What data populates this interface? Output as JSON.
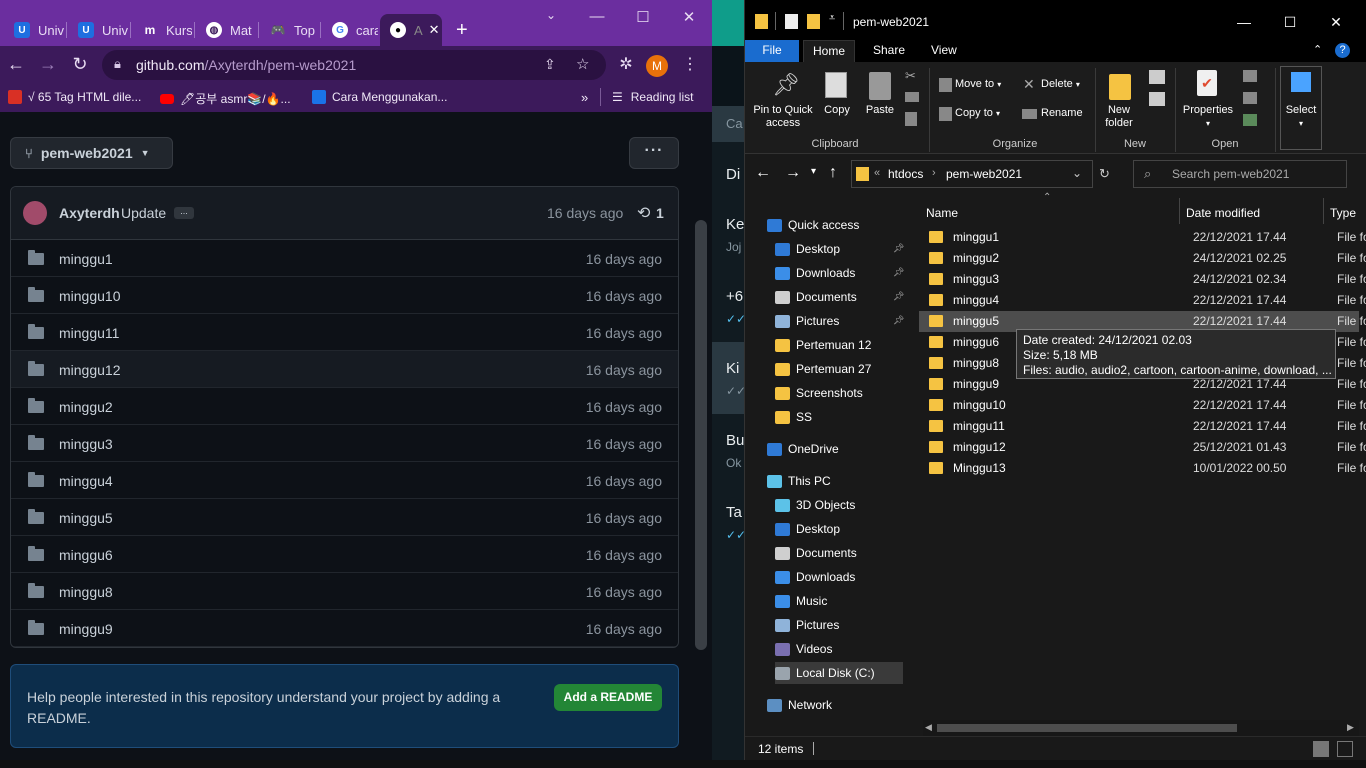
{
  "chrome": {
    "tabs": [
      {
        "label": "Univ",
        "icon": "univ-favicon"
      },
      {
        "label": "Univ",
        "icon": "univ-favicon"
      },
      {
        "label": "Kurs",
        "icon": "m-favicon"
      },
      {
        "label": "Mat",
        "icon": "globe-favicon"
      },
      {
        "label": "Top",
        "icon": "gamepad-favicon"
      },
      {
        "label": "cara",
        "icon": "google-favicon"
      },
      {
        "label": "A",
        "icon": "github-favicon"
      }
    ],
    "url_host": "github.com",
    "url_path": "/Axyterdh/pem-web2021",
    "profile_initial": "M",
    "bookmarks": [
      {
        "label": "√ 65 Tag HTML dile...",
        "icon": "home-icon"
      },
      {
        "label": "🖊공부 asmr📚/🔥...",
        "icon": "youtube-icon"
      },
      {
        "label": "Cara Menggunakan...",
        "icon": "wave-icon"
      }
    ],
    "reading_list": "Reading list",
    "colors": {
      "tabbar": "#6b2e9f",
      "toolbar": "#3c1a5b"
    }
  },
  "github": {
    "branch": "pem-web2021",
    "commit_author": "Axyterdh",
    "commit_message": "Update",
    "commit_age": "16 days ago",
    "commit_count": "1",
    "files": [
      {
        "name": "minggu1",
        "age": "16 days ago"
      },
      {
        "name": "minggu10",
        "age": "16 days ago"
      },
      {
        "name": "minggu11",
        "age": "16 days ago"
      },
      {
        "name": "minggu12",
        "age": "16 days ago"
      },
      {
        "name": "minggu2",
        "age": "16 days ago"
      },
      {
        "name": "minggu3",
        "age": "16 days ago"
      },
      {
        "name": "minggu4",
        "age": "16 days ago"
      },
      {
        "name": "minggu5",
        "age": "16 days ago"
      },
      {
        "name": "minggu6",
        "age": "16 days ago"
      },
      {
        "name": "minggu8",
        "age": "16 days ago"
      },
      {
        "name": "minggu9",
        "age": "16 days ago"
      }
    ],
    "readme_message": "Help people interested in this repository understand your project by adding a README.",
    "readme_button": "Add a README"
  },
  "middle": {
    "fragments": [
      "Ca",
      "Di",
      "Ke",
      "Joj",
      "+6",
      "Ki",
      "Bu",
      "Ok",
      "Ta"
    ]
  },
  "explorer": {
    "title": "pem-web2021",
    "ribbon_tabs": {
      "file": "File",
      "home": "Home",
      "share": "Share",
      "view": "View"
    },
    "ribbon": {
      "pin": "Pin to Quick access",
      "copy": "Copy",
      "paste": "Paste",
      "clipboard": "Clipboard",
      "move_to": "Move to",
      "copy_to": "Copy to",
      "delete": "Delete",
      "rename": "Rename",
      "organize": "Organize",
      "new_folder": "New folder",
      "new": "New",
      "properties": "Properties",
      "open": "Open",
      "select": "Select"
    },
    "breadcrumb": [
      "htdocs",
      "pem-web2021"
    ],
    "search_placeholder": "Search pem-web2021",
    "nav": {
      "quick_access": "Quick access",
      "quick_items": [
        "Desktop",
        "Downloads",
        "Documents",
        "Pictures",
        "Pertemuan 12",
        "Pertemuan 27",
        "Screenshots",
        "SS"
      ],
      "onedrive": "OneDrive",
      "this_pc": "This PC",
      "pc_items": [
        "3D Objects",
        "Desktop",
        "Documents",
        "Downloads",
        "Music",
        "Pictures",
        "Videos",
        "Local Disk (C:)"
      ],
      "network": "Network"
    },
    "columns": {
      "name": "Name",
      "date": "Date modified",
      "type": "Type"
    },
    "files": [
      {
        "name": "minggu1",
        "date": "22/12/2021 17.44",
        "type": "File fo"
      },
      {
        "name": "minggu2",
        "date": "24/12/2021 02.25",
        "type": "File fo"
      },
      {
        "name": "minggu3",
        "date": "24/12/2021 02.34",
        "type": "File fo"
      },
      {
        "name": "minggu4",
        "date": "22/12/2021 17.44",
        "type": "File fo"
      },
      {
        "name": "minggu5",
        "date": "22/12/2021 17.44",
        "type": "File fo"
      },
      {
        "name": "minggu6",
        "date": "",
        "type": "File fo"
      },
      {
        "name": "minggu8",
        "date": "",
        "type": "File fo"
      },
      {
        "name": "minggu9",
        "date": "22/12/2021 17.44",
        "type": "File fo"
      },
      {
        "name": "minggu10",
        "date": "22/12/2021 17.44",
        "type": "File fo"
      },
      {
        "name": "minggu11",
        "date": "22/12/2021 17.44",
        "type": "File fo"
      },
      {
        "name": "minggu12",
        "date": "25/12/2021 01.43",
        "type": "File fo"
      },
      {
        "name": "Minggu13",
        "date": "10/01/2022 00.50",
        "type": "File fo"
      }
    ],
    "tooltip": {
      "created": "Date created: 24/12/2021 02.03",
      "size": "Size: 5,18 MB",
      "files": "Files: audio, audio2, cartoon, cartoon-anime, download, ..."
    },
    "status": "12 items"
  }
}
